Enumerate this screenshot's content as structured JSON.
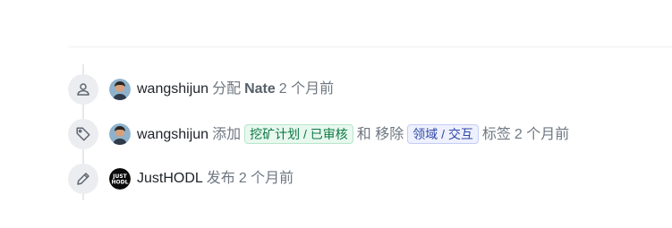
{
  "events": [
    {
      "icon": "user-icon",
      "user": "wangshijun",
      "action": "分配",
      "target": "Nate",
      "time": "2 个月前"
    },
    {
      "icon": "tag-icon",
      "user": "wangshijun",
      "action_add": "添加",
      "added_label": {
        "text": "挖矿计划 / 已审核",
        "color": "#0e7a43"
      },
      "and_remove": "和 移除",
      "removed_label": {
        "text": "领域 / 交互",
        "color": "#3048a8"
      },
      "suffix": "标签",
      "time": "2 个月前"
    },
    {
      "icon": "pencil-icon",
      "user": "JustHODL",
      "action": "发布",
      "time": "2 个月前",
      "avatar_text": "JUST HODL"
    }
  ]
}
